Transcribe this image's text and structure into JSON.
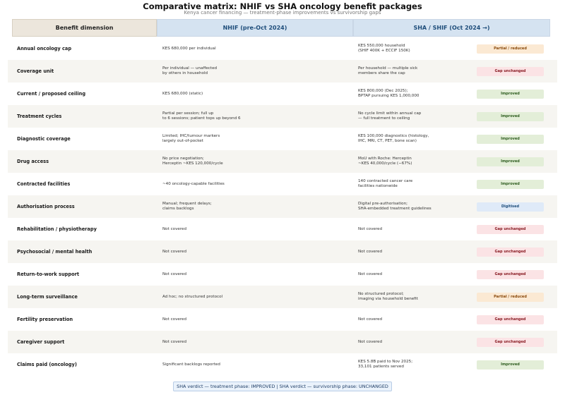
{
  "title": "Comparative matrix: NHIF vs SHA oncology benefit packages",
  "subtitle": "Kenya cancer financing — treatment-phase improvements vs survivorship gaps",
  "colors": {
    "improved_bg": "#e3eed8",
    "improved_fg": "#2e5d1f",
    "gap_bg": "#fbe3e5",
    "gap_fg": "#8a1c24",
    "partial_bg": "#fbe9d3",
    "partial_fg": "#8a4a0c",
    "digitised_bg": "#dfeaf8",
    "digitised_fg": "#1e4d7a"
  },
  "chart_data": {
    "type": "table",
    "columns": [
      "Benefit dimension",
      "NHIF (pre-Oct 2024)",
      "SHA / SHIF (Oct 2024 →)"
    ],
    "rows": [
      {
        "dimension": "Annual oncology cap",
        "nhif": "KES 680,000 per individual",
        "sha": "KES 550,000 household\n(SHIF 400K + ECCIF 150K)",
        "verdict": "Partial / reduced",
        "status": "partial"
      },
      {
        "dimension": "Coverage unit",
        "nhif": "Per individual — unaffected\nby others in household",
        "sha": "Per household — multiple sick\nmembers share the cap",
        "verdict": "Gap unchanged",
        "status": "gap"
      },
      {
        "dimension": "Current / proposed ceiling",
        "nhif": "KES 680,000 (static)",
        "sha": "KES 800,000 (Dec 2025);\nBPTAP pursuing KES 1,000,000",
        "verdict": "Improved",
        "status": "improved"
      },
      {
        "dimension": "Treatment cycles",
        "nhif": "Partial per session; full up\nto 6 sessions; patient tops up beyond 6",
        "sha": "No cycle limit within annual cap\n— full treatment to ceiling",
        "verdict": "Improved",
        "status": "improved"
      },
      {
        "dimension": "Diagnostic coverage",
        "nhif": "Limited; IHC/tumour markers\nlargely out-of-pocket",
        "sha": "KES 100,000 diagnostics (histology,\nIHC, MRI, CT, PET, bone scan)",
        "verdict": "Improved",
        "status": "improved"
      },
      {
        "dimension": "Drug access",
        "nhif": "No price negotiation;\nHerceptin ~KES 120,000/cycle",
        "sha": "MoU with Roche: Herceptin\n~KES 40,000/cycle (−67%)",
        "verdict": "Improved",
        "status": "improved"
      },
      {
        "dimension": "Contracted facilities",
        "nhif": "~40 oncology-capable facilities",
        "sha": "140 contracted cancer care\nfacilities nationwide",
        "verdict": "Improved",
        "status": "improved"
      },
      {
        "dimension": "Authorisation process",
        "nhif": "Manual; frequent delays;\nclaims backlogs",
        "sha": "Digital pre-authorisation;\nSHA-embedded treatment guidelines",
        "verdict": "Digitised",
        "status": "digitised"
      },
      {
        "dimension": "Rehabilitation / physiotherapy",
        "nhif": "Not covered",
        "sha": "Not covered",
        "verdict": "Gap unchanged",
        "status": "gap"
      },
      {
        "dimension": "Psychosocial / mental health",
        "nhif": "Not covered",
        "sha": "Not covered",
        "verdict": "Gap unchanged",
        "status": "gap"
      },
      {
        "dimension": "Return-to-work support",
        "nhif": "Not covered",
        "sha": "Not covered",
        "verdict": "Gap unchanged",
        "status": "gap"
      },
      {
        "dimension": "Long-term surveillance",
        "nhif": "Ad hoc; no structured protocol",
        "sha": "No structured protocol;\nimaging via household benefit",
        "verdict": "Partial / reduced",
        "status": "partial"
      },
      {
        "dimension": "Fertility preservation",
        "nhif": "Not covered",
        "sha": "Not covered",
        "verdict": "Gap unchanged",
        "status": "gap"
      },
      {
        "dimension": "Caregiver support",
        "nhif": "Not covered",
        "sha": "Not covered",
        "verdict": "Gap unchanged",
        "status": "gap"
      },
      {
        "dimension": "Claims paid (oncology)",
        "nhif": "Significant backlogs reported",
        "sha": "KES 5.8B paid to Nov 2025;\n33,101 patients served",
        "verdict": "Improved",
        "status": "improved"
      }
    ]
  },
  "footer": "SHA verdict — treatment phase: IMPROVED  |  SHA verdict — survivorship phase: UNCHANGED"
}
